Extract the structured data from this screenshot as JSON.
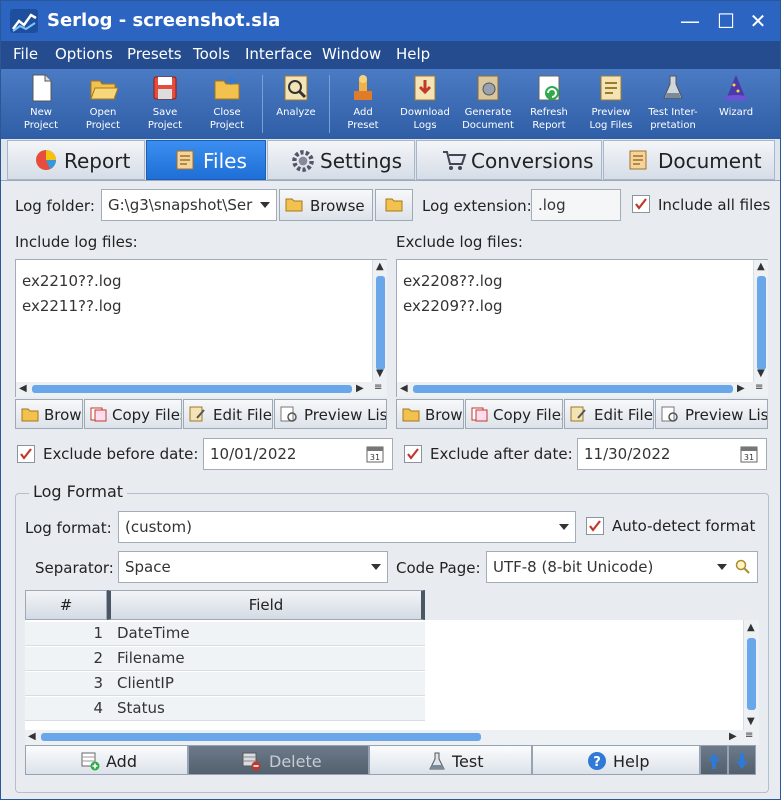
{
  "window": {
    "title": "Serlog - screenshot.sla",
    "minimize": "—",
    "maximize": "☐",
    "close": "✕"
  },
  "menu": [
    "File",
    "Options",
    "Presets",
    "Tools",
    "Interface",
    "Window",
    "Help"
  ],
  "toolbar": [
    {
      "l1": "New",
      "l2": "Project",
      "icon": "new-project-icon"
    },
    {
      "l1": "Open",
      "l2": "Project",
      "icon": "open-folder-icon"
    },
    {
      "l1": "Save",
      "l2": "Project",
      "icon": "save-icon"
    },
    {
      "l1": "Close",
      "l2": "Project",
      "icon": "close-project-icon"
    },
    {
      "l1": "Analyze",
      "l2": "",
      "icon": "analyze-icon"
    },
    {
      "l1": "Add",
      "l2": "Preset",
      "icon": "add-preset-icon"
    },
    {
      "l1": "Download",
      "l2": "Logs",
      "icon": "download-icon"
    },
    {
      "l1": "Generate",
      "l2": "Document",
      "icon": "generate-document-icon"
    },
    {
      "l1": "Refresh",
      "l2": "Report",
      "icon": "refresh-icon"
    },
    {
      "l1": "Preview",
      "l2": "Log Files",
      "icon": "preview-icon"
    },
    {
      "l1": "Test Inter-",
      "l2": "pretation",
      "icon": "test-flask-icon"
    },
    {
      "l1": "Wizard",
      "l2": "",
      "icon": "wizard-icon"
    }
  ],
  "tabs": [
    "Report",
    "Files",
    "Settings",
    "Conversions",
    "Document"
  ],
  "active_tab": "Files",
  "files": {
    "log_folder_label": "Log folder:",
    "log_folder_value": "G:\\g3\\snapshot\\Ser",
    "browse_label": "Browse",
    "log_extension_label": "Log extension:",
    "log_extension_value": ".log",
    "include_all_label": "Include all files",
    "include_all_checked": true,
    "include_label": "Include log files:",
    "include_items": [
      "ex2210??.log",
      "ex2211??.log"
    ],
    "exclude_label": "Exclude log files:",
    "exclude_items": [
      "ex2208??.log",
      "ex2209??.log"
    ],
    "list_buttons": [
      "Brow",
      "Copy Files",
      "Edit Files",
      "Preview List"
    ],
    "exclude_before_label": "Exclude before date:",
    "exclude_before_value": "10/01/2022",
    "exclude_before_checked": true,
    "exclude_after_label": "Exclude after date:",
    "exclude_after_value": "11/30/2022",
    "exclude_after_checked": true,
    "calendar_day": "31"
  },
  "log_format": {
    "group_title": "Log Format",
    "format_label": "Log format:",
    "format_value": "(custom)",
    "auto_detect_label": "Auto-detect format",
    "auto_detect_checked": true,
    "separator_label": "Separator:",
    "separator_value": "Space",
    "code_page_label": "Code Page:",
    "code_page_value": "UTF-8 (8-bit Unicode)",
    "col_num": "#",
    "col_field": "Field",
    "rows": [
      {
        "n": "1",
        "field": "DateTime"
      },
      {
        "n": "2",
        "field": "Filename"
      },
      {
        "n": "3",
        "field": "ClientIP"
      },
      {
        "n": "4",
        "field": "Status"
      }
    ]
  },
  "bottom_buttons": {
    "add": "Add",
    "delete": "Delete",
    "test": "Test",
    "help": "Help"
  },
  "colors": {
    "titlebar": "#2c64c2",
    "active_tab": "#2a7fe6",
    "check": "#c0392b"
  }
}
